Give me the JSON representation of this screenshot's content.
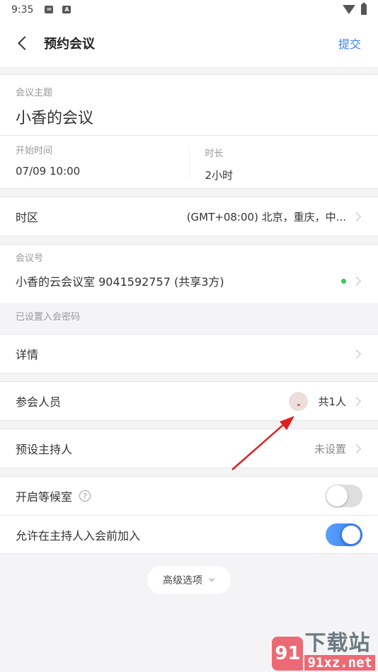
{
  "status_bar": {
    "time": "9:35",
    "icons": [
      "mail-icon",
      "a-icon"
    ],
    "right_icons": [
      "wifi-icon",
      "battery-charging-icon"
    ]
  },
  "header": {
    "back_icon": "chevron-left-icon",
    "title": "预约会议",
    "submit_label": "提交"
  },
  "topic": {
    "label": "会议主题",
    "value": "小香的会议"
  },
  "time": {
    "start_label": "开始时间",
    "start_value": "07/09 10:00",
    "duration_label": "时长",
    "duration_value": "2小时"
  },
  "timezone": {
    "label": "时区",
    "value": "(GMT+08:00) 北京，重庆，中..."
  },
  "meeting_id": {
    "label": "会议号",
    "value": "小香的云会议室 9041592757 (共享3方)",
    "status_color": "#32c85a"
  },
  "password_note": "已设置入会密码",
  "details": {
    "label": "详情"
  },
  "participants": {
    "label": "参会人员",
    "count": "共1人"
  },
  "host": {
    "label": "预设主持人",
    "value": "未设置"
  },
  "waiting_room": {
    "label": "开启等候室",
    "help_icon": "?",
    "enabled": false
  },
  "join_before_host": {
    "label": "允许在主持人入会前加入",
    "enabled": true
  },
  "advanced": {
    "label": "高级选项"
  },
  "watermark": {
    "logo": "91",
    "cn": "下载站",
    "en": "91xz.net"
  },
  "colors": {
    "accent": "#3c82f0",
    "annotation_arrow": "#e02020"
  }
}
